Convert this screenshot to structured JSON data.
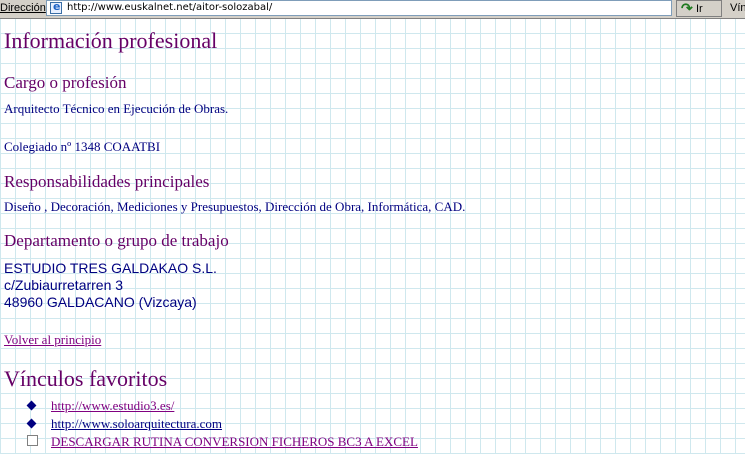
{
  "addressbar": {
    "label": "Dirección",
    "url": "http://www.euskalnet.net/aitor-solozabal/",
    "go_label": "Ir",
    "links_label": "Vín"
  },
  "page": {
    "title": "Información profesional",
    "cargo": {
      "heading": "Cargo o profesión",
      "line1": "Arquitecto Técnico en Ejecución de Obras.",
      "line2": "Colegiado nº 1348 COAATBI"
    },
    "responsabilidades": {
      "heading": "Responsabilidades principales",
      "text": "Diseño , Decoración, Mediciones y Presupuestos, Dirección de Obra, Informática, CAD."
    },
    "departamento": {
      "heading": "Departamento o grupo de trabajo",
      "company": "ESTUDIO TRES GALDAKAO S.L.",
      "street": "c/Zubiaurretarren 3",
      "city": "48960 GALDACANO (Vizcaya)"
    },
    "back_link": "Volver al principio",
    "favorites": {
      "heading": "Vínculos favoritos",
      "items": [
        {
          "label": "http://www.estudio3.es/"
        },
        {
          "label": "http://www.soloarquitectura.com"
        },
        {
          "label": "DESCARGAR RUTINA CONVERSION FICHEROS BC3 A EXCEL"
        }
      ]
    }
  },
  "colors": {
    "heading": "#660066",
    "body_text": "#000080",
    "visited_link": "#800080",
    "grid": "#cfe8ee"
  }
}
